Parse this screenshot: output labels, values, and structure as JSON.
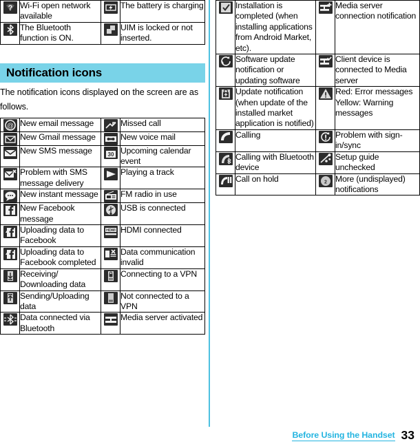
{
  "column_rule_color": "#4cc0e0",
  "section": {
    "band_color": "#79d3e8",
    "title": "Notification icons",
    "intro": "The notification icons displayed on the screen are as follows."
  },
  "top_table": {
    "rows": [
      [
        {
          "icon": "wifi-open-network-icon",
          "text": "Wi-Fi open network available"
        },
        {
          "icon": "battery-charging-icon",
          "text": "The battery is charging"
        }
      ],
      [
        {
          "icon": "bluetooth-on-icon",
          "text": "The Bluetooth function is ON."
        },
        {
          "icon": "uim-locked-icon",
          "text": "UIM is locked or not inserted."
        }
      ]
    ]
  },
  "main_table": {
    "rows": [
      [
        {
          "icon": "new-email-icon",
          "text": "New email message"
        },
        {
          "icon": "missed-call-icon",
          "text": "Missed call"
        }
      ],
      [
        {
          "icon": "new-gmail-icon",
          "text": "New Gmail message"
        },
        {
          "icon": "new-voice-mail-icon",
          "text": "New voice mail"
        }
      ],
      [
        {
          "icon": "new-sms-icon",
          "text": "New SMS message"
        },
        {
          "icon": "calendar-event-icon",
          "text": "Upcoming calendar event"
        }
      ],
      [
        {
          "icon": "sms-delivery-problem-icon",
          "text": "Problem with SMS message delivery"
        },
        {
          "icon": "playing-track-icon",
          "text": "Playing a track"
        }
      ],
      [
        {
          "icon": "new-instant-message-icon",
          "text": "New instant message"
        },
        {
          "icon": "fm-radio-icon",
          "text": "FM radio in use"
        }
      ],
      [
        {
          "icon": "new-facebook-message-icon",
          "text": "New Facebook message"
        },
        {
          "icon": "usb-connected-icon",
          "text": "USB is connected"
        }
      ],
      [
        {
          "icon": "facebook-upload-icon",
          "text": "Uploading data to Facebook"
        },
        {
          "icon": "hdmi-connected-icon",
          "text": "HDMI connected"
        }
      ],
      [
        {
          "icon": "facebook-upload-complete-icon",
          "text": "Uploading data to Facebook completed"
        },
        {
          "icon": "data-communication-invalid-icon",
          "text": "Data communication invalid"
        }
      ],
      [
        {
          "icon": "downloading-data-icon",
          "text": "Receiving/ Downloading data"
        },
        {
          "icon": "vpn-connecting-icon",
          "text": "Connecting to a VPN"
        }
      ],
      [
        {
          "icon": "uploading-data-icon",
          "text": "Sending/Uploading data"
        },
        {
          "icon": "vpn-disconnected-icon",
          "text": "Not connected to a VPN"
        }
      ],
      [
        {
          "icon": "bluetooth-data-icon",
          "text": "Data connected via Bluetooth"
        },
        {
          "icon": "media-server-active-icon",
          "text": "Media server activated"
        }
      ]
    ]
  },
  "right_table": {
    "rows": [
      [
        {
          "icon": "install-complete-icon",
          "text": "Installation is completed (when installing applications from Android Market, etc)."
        },
        {
          "icon": "media-server-connection-icon",
          "text": "Media server connection notification"
        }
      ],
      [
        {
          "icon": "software-update-icon",
          "text": "Software update notification or updating software"
        },
        {
          "icon": "media-client-connected-icon",
          "text": "Client device is connected to Media server"
        }
      ],
      [
        {
          "icon": "market-update-icon",
          "text": "Update notification (when update of the installed market application is notified)"
        },
        {
          "icon": "warning-triangle-icon",
          "text": "Red: Error messages\nYellow: Warning messages"
        }
      ],
      [
        {
          "icon": "calling-icon",
          "text": "Calling"
        },
        {
          "icon": "sync-problem-icon",
          "text": "Problem with sign-in/sync"
        }
      ],
      [
        {
          "icon": "calling-bluetooth-icon",
          "text": "Calling with Bluetooth device"
        },
        {
          "icon": "setup-guide-icon",
          "text": "Setup guide unchecked"
        }
      ],
      [
        {
          "icon": "call-on-hold-icon",
          "text": "Call on hold"
        },
        {
          "icon": "more-notifications-icon",
          "text": "More (undisplayed) notifications"
        }
      ]
    ]
  },
  "footer": {
    "chapter": "Before Using the Handset",
    "page_number": "33",
    "link_color": "#23b4e0"
  }
}
